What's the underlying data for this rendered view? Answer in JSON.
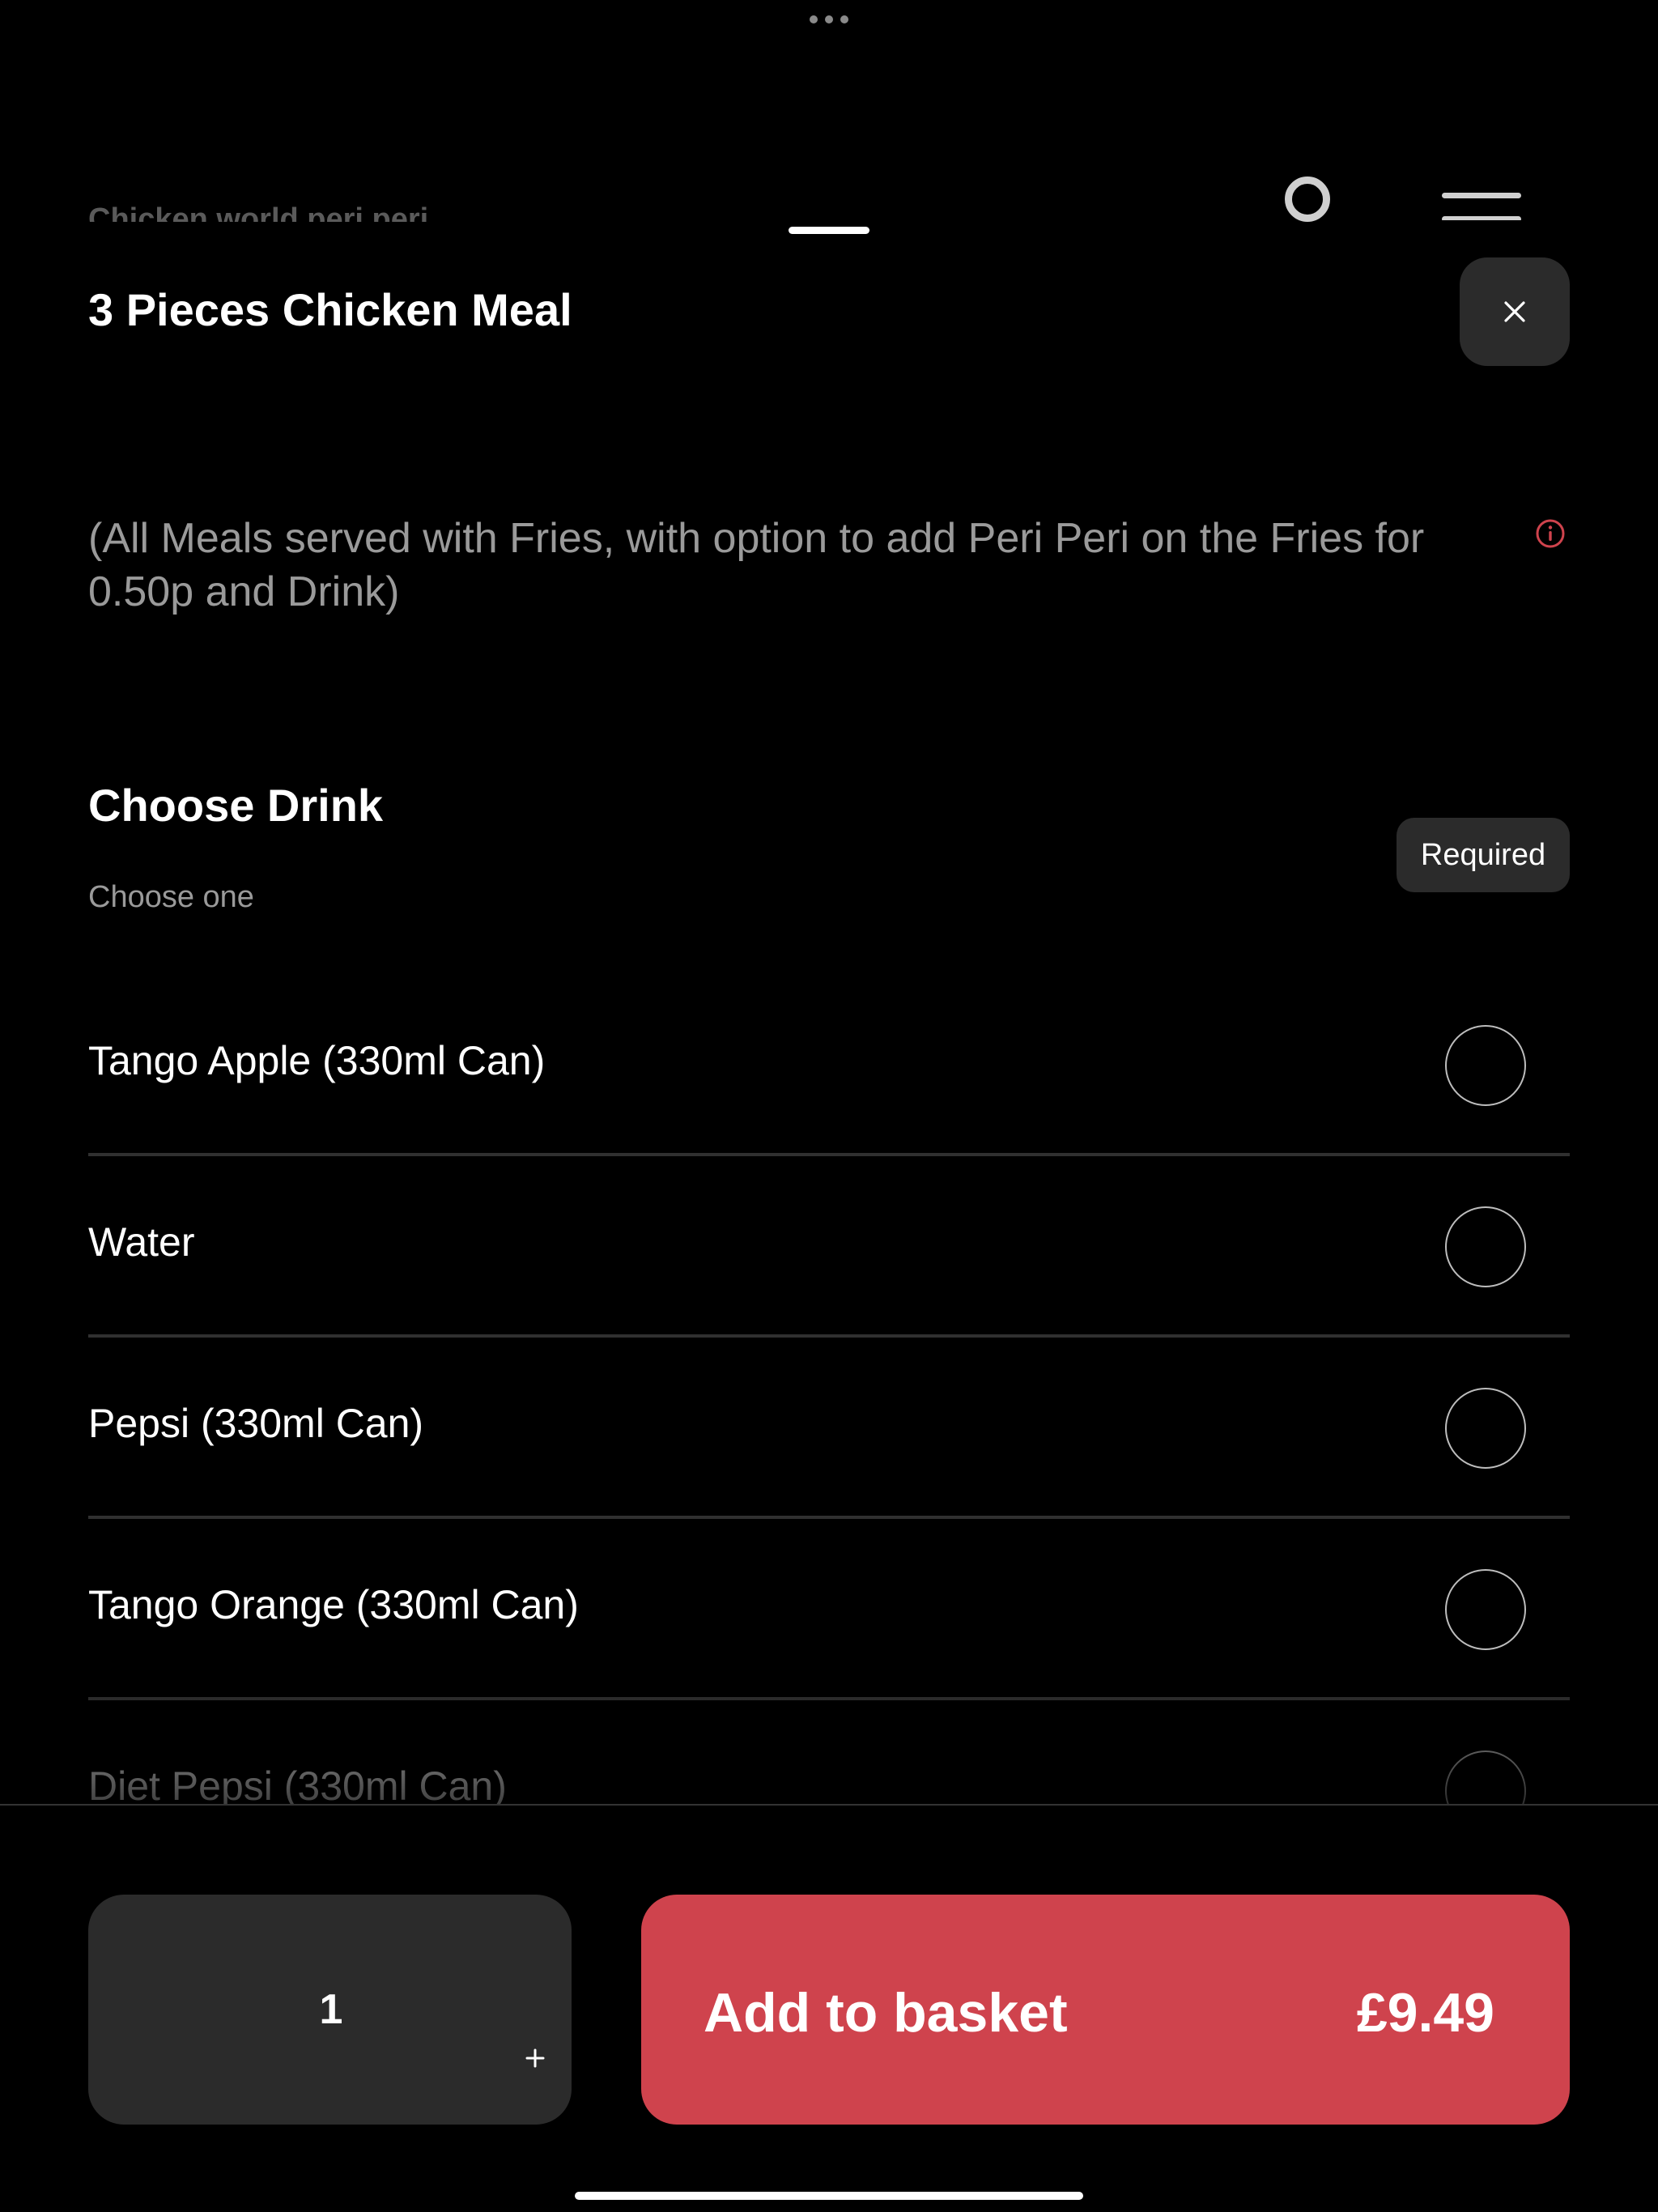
{
  "background": {
    "restaurant_name": "Chicken world peri peri"
  },
  "item": {
    "title": "3 Pieces Chicken Meal",
    "description": "(All Meals served with Fries, with option to add Peri Peri on the Fries for 0.50p and Drink)"
  },
  "drink_section": {
    "title": "Choose Drink",
    "subtitle": "Choose one",
    "badge": "Required",
    "options": [
      {
        "label": "Tango Apple (330ml Can)"
      },
      {
        "label": "Water"
      },
      {
        "label": "Pepsi (330ml Can)"
      },
      {
        "label": "Tango Orange (330ml Can)"
      },
      {
        "label": "Diet Pepsi (330ml Can)"
      }
    ]
  },
  "footer": {
    "quantity": "1",
    "increment_label": "+",
    "add_label": "Add to basket",
    "price": "£9.49"
  },
  "colors": {
    "background": "#000000",
    "surface": "#2b2b2b",
    "accent": "#cf434d",
    "muted_text": "#9a9a9a",
    "divider": "#303030"
  },
  "icons": {
    "close": "close-icon",
    "info": "info-icon",
    "plus": "plus-icon",
    "top_dots": "more-dots-icon",
    "menu": "menu-icon"
  }
}
